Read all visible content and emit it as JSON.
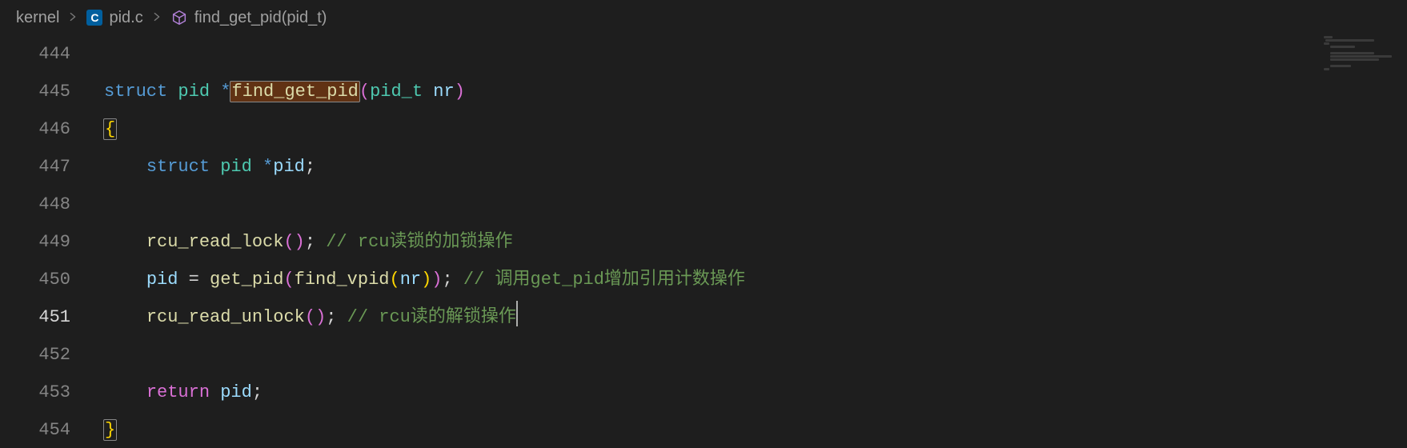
{
  "breadcrumb": {
    "folder": "kernel",
    "file_icon_letter": "C",
    "file": "pid.c",
    "symbol": "find_get_pid(pid_t)"
  },
  "editor": {
    "line_numbers": [
      "444",
      "445",
      "446",
      "447",
      "448",
      "449",
      "450",
      "451",
      "452",
      "453",
      "454"
    ],
    "current_line_index": 7,
    "tokens": {
      "l445_struct": "struct",
      "l445_pid_t1": "pid",
      "l445_star": "*",
      "l445_fn": "find_get_pid",
      "l445_lp": "(",
      "l445_pidt": "pid_t",
      "l445_nr": "nr",
      "l445_rp": ")",
      "l446_lbrace": "{",
      "l447_struct": "struct",
      "l447_pid_t": "pid",
      "l447_star": "*",
      "l447_pid_v": "pid",
      "l447_semi": ";",
      "l449_fn": "rcu_read_lock",
      "l449_lp": "(",
      "l449_rp": ")",
      "l449_semi": ";",
      "l449_com": "// rcu读锁的加锁操作",
      "l450_pid": "pid",
      "l450_eq": "=",
      "l450_getpid": "get_pid",
      "l450_lp1": "(",
      "l450_findvpid": "find_vpid",
      "l450_lp2": "(",
      "l450_nr": "nr",
      "l450_rp2": ")",
      "l450_rp1": ")",
      "l450_semi": ";",
      "l450_com": "// 调用get_pid增加引用计数操作",
      "l451_fn": "rcu_read_unlock",
      "l451_lp": "(",
      "l451_rp": ")",
      "l451_semi": ";",
      "l451_com": "// rcu读的解锁操作",
      "l453_return": "return",
      "l453_pid": "pid",
      "l453_semi": ";",
      "l454_rbrace": "}"
    }
  }
}
